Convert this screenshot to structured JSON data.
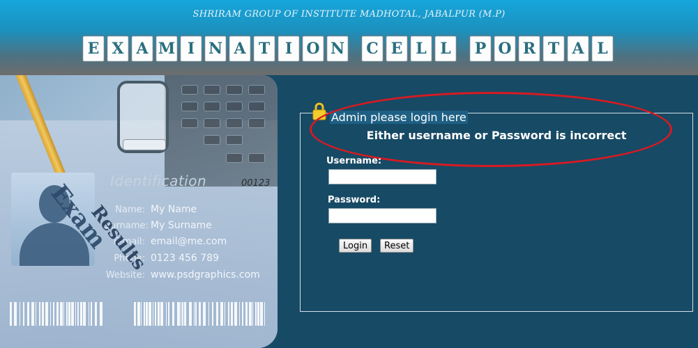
{
  "header": {
    "institute": "SHRIRAM GROUP OF INSTITUTE MADHOTAL, JABALPUR (M.P)",
    "portal_title": "EXAMINATION CELL PORTAL",
    "title_tiles": [
      "E",
      "X",
      "A",
      "M",
      "I",
      "N",
      "A",
      "T",
      "I",
      "O",
      "N",
      "C",
      "E",
      "L",
      "L",
      "P",
      "O",
      "R",
      "T",
      "A",
      "L"
    ]
  },
  "id_card": {
    "identification": "Identification",
    "serial": "00123",
    "exam_word": "Exam",
    "results_word": "Results",
    "fields": [
      {
        "label": "Name:",
        "value": "My Name"
      },
      {
        "label": "Surname:",
        "value": "My Surname"
      },
      {
        "label": "E-mail:",
        "value": "email@me.com"
      },
      {
        "label": "Phone:",
        "value": "0123 456 789"
      },
      {
        "label": "Website:",
        "value": "www.psdgraphics.com"
      }
    ]
  },
  "login": {
    "legend": "Admin please login here",
    "error": "Either username or Password is incorrect",
    "username_label": "Username:",
    "password_label": "Password:",
    "username_value": "",
    "password_value": "",
    "login_button": "Login",
    "reset_button": "Reset"
  },
  "colors": {
    "page_bg": "#174a65",
    "annotation_circle": "#d81a22",
    "title_letters": "#2a6f7f"
  }
}
